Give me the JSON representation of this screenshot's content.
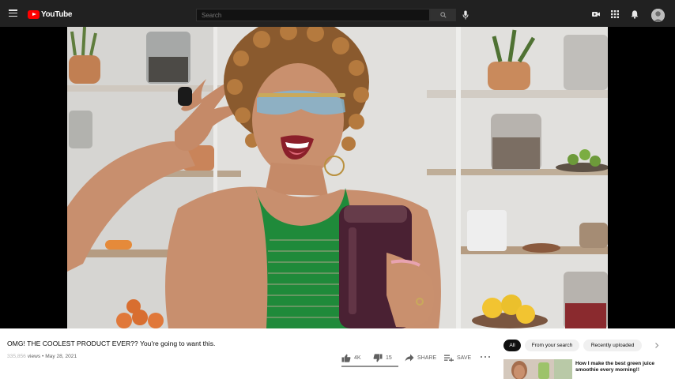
{
  "header": {
    "logo_text": "YouTube",
    "search": {
      "placeholder": "Search",
      "value": ""
    },
    "icons": [
      "menu-icon",
      "search-icon",
      "mic-icon",
      "create-video-icon",
      "apps-grid-icon",
      "bell-icon",
      "avatar"
    ]
  },
  "video": {
    "title": "OMG! THE COOLEST PRODUCT EVER?? You're going to want this.",
    "views": "335,856",
    "views_suffix": "views",
    "separator": "•",
    "date": "May 28, 2021",
    "like_ratio": 0.9996
  },
  "actions": {
    "likes": "4K",
    "dislikes": "15",
    "share": "SHARE",
    "save": "SAVE"
  },
  "chips": {
    "all": "All",
    "from_search": "From your search",
    "recently_uploaded": "Recently uploaded"
  },
  "recommendation": {
    "title": "How I make the best green juice smoothie every morning!!"
  },
  "colors": {
    "brand_red": "#ff0000",
    "topbar": "#212121",
    "player_bg": "#000000",
    "shirt_green": "#1f8a3a"
  }
}
